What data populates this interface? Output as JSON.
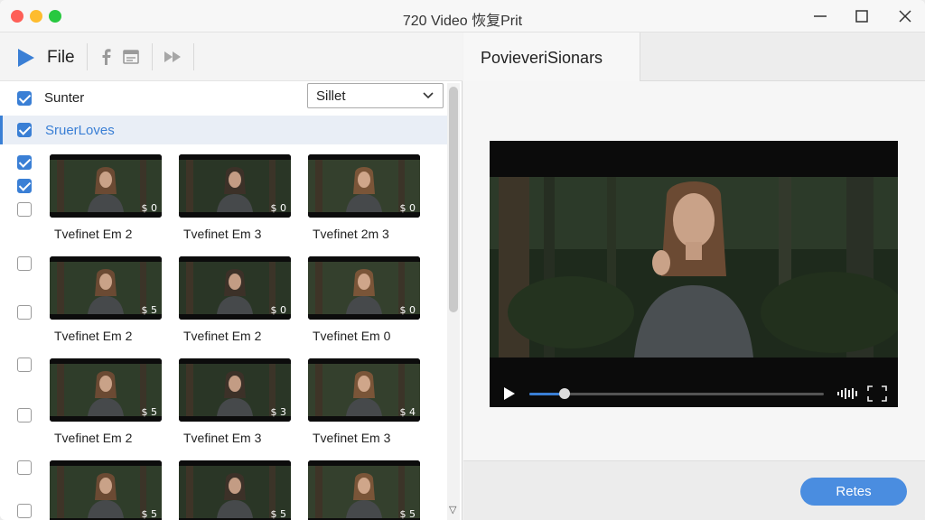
{
  "window": {
    "title": "720 Video 恢复Prit"
  },
  "toolbar": {
    "file_label": "File"
  },
  "sorter": {
    "label": "Sunter",
    "checked": true
  },
  "select": {
    "value": "Sillet"
  },
  "group": {
    "label": "SruerLoves",
    "checked": true
  },
  "checkboxes": [
    true,
    true,
    false,
    false,
    false,
    false,
    false,
    false,
    false
  ],
  "thumbnails": [
    {
      "label": "Tvefinet Em 2",
      "badge": "$ 0"
    },
    {
      "label": "Tvefinet Em 3",
      "badge": "$ 0"
    },
    {
      "label": "Tvefinet 2m 3",
      "badge": "$ 0"
    },
    {
      "label": "Tvefinet Em 2",
      "badge": "$ 5"
    },
    {
      "label": "Tvefinet Em 2",
      "badge": "$ 0"
    },
    {
      "label": "Tvefinet Em 0",
      "badge": "$ 0"
    },
    {
      "label": "Tvefinet Em 2",
      "badge": "$ 5"
    },
    {
      "label": "Tvefinet Em 3",
      "badge": "$ 3"
    },
    {
      "label": "Tvefinet Em 3",
      "badge": "$ 4"
    },
    {
      "label": "",
      "badge": "$ 5"
    },
    {
      "label": "",
      "badge": "$ 5"
    },
    {
      "label": "",
      "badge": "$ 5"
    }
  ],
  "preview": {
    "tab_label": "PovieveriSionars",
    "progress": 0.12
  },
  "footer": {
    "button_label": "Retes"
  },
  "colors": {
    "accent": "#3a7fd5",
    "button": "#4a8de0"
  }
}
